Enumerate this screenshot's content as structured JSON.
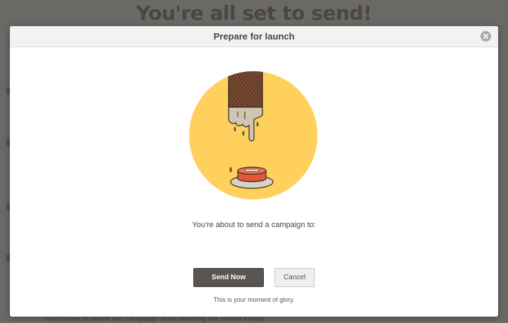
{
  "background": {
    "heading": "You're all set to send!",
    "footer_text": "You chose to share the campaign after sending via Social Media"
  },
  "modal": {
    "title": "Prepare for launch",
    "illustration": "finger-pressing-red-button",
    "message": "You're about to send a campaign to:",
    "send_label": "Send Now",
    "cancel_label": "Cancel",
    "tagline": "This is your moment of glory."
  },
  "colors": {
    "overlay": "#6b6966",
    "illustration_circle": "#ffd15c",
    "button_red": "#e2573a",
    "send_button": "#585552"
  },
  "icons": {
    "close": "close-icon"
  }
}
